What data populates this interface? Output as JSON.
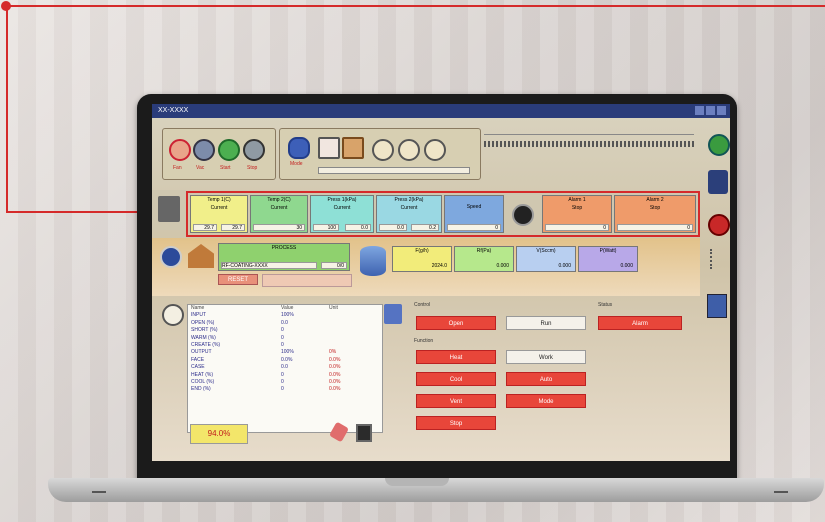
{
  "window": {
    "title": "XX-XXXX"
  },
  "toolbar": {
    "icons": [
      {
        "name": "fan-icon",
        "label": "Fan"
      },
      {
        "name": "vacuum-icon",
        "label": "Vac"
      },
      {
        "name": "runner-icon",
        "label": "Start"
      },
      {
        "name": "gauge-icon",
        "label": "Stop"
      }
    ],
    "icons2": [
      {
        "name": "user-icon",
        "label": "Mode"
      },
      {
        "name": "document-icon",
        "label": ""
      },
      {
        "name": "broom-icon",
        "label": ""
      }
    ],
    "dials_count": 3
  },
  "status_boxes": [
    {
      "title": "Temp 1(C)",
      "sub": "Current",
      "value": "29.7",
      "value2": "29.7",
      "color": "#f1ef8a"
    },
    {
      "title": "Temp 2(C)",
      "sub": "Current",
      "value": "30",
      "value2": "",
      "color": "#8fd88f"
    },
    {
      "title": "Press 1(kPa)",
      "sub": "Current",
      "value": "100",
      "value2": "0.0",
      "color": "#8ee0d6"
    },
    {
      "title": "Press 2(kPa)",
      "sub": "Current",
      "value": "0.0",
      "value2": "0.2",
      "color": "#9ad8e3"
    },
    {
      "title": "Speed",
      "sub": "",
      "value": "0",
      "value2": "",
      "color": "#7ea8de"
    },
    {
      "title": "Alarm 1",
      "sub": "Stop",
      "value": "0",
      "value2": "",
      "color": "#ef9b6a"
    },
    {
      "title": "Alarm 2",
      "sub": "Stop",
      "value": "0",
      "value2": "",
      "color": "#ef9b6a"
    }
  ],
  "process": {
    "name_label": "PROCESS",
    "name_value": "RF-COATING-XXXX",
    "count_label": "0/0",
    "reset_label": "RESET",
    "readouts": [
      {
        "label": "F(g/h)",
        "value": "2024.0",
        "color": "#f2ec7a"
      },
      {
        "label": "Rf(Pa)",
        "value": "0.000",
        "color": "#b6e88c"
      },
      {
        "label": "V(Sccm)",
        "value": "0.000",
        "color": "#b8cff0"
      },
      {
        "label": "P(Watt)",
        "value": "0.000",
        "color": "#b8a8e8"
      }
    ]
  },
  "table": {
    "headers": [
      "Name",
      "Value",
      "Unit"
    ],
    "rows": [
      [
        "INPUT",
        "100%",
        ""
      ],
      [
        "OPEN (%)",
        "0.0",
        ""
      ],
      [
        "SHORT (%)",
        "0",
        ""
      ],
      [
        "WARM (%)",
        "0",
        ""
      ],
      [
        "CREATE (%)",
        "0",
        ""
      ],
      [
        "OUTPUT",
        "100%",
        "0%"
      ],
      [
        "FACE",
        "0.0%",
        "0.0%"
      ],
      [
        "CASE",
        "0.0",
        "0.0%"
      ],
      [
        "HEAT (%)",
        "0",
        "0.0%"
      ],
      [
        "COOL (%)",
        "0",
        "0.0%"
      ],
      [
        "END (%)",
        "0",
        "0.0%"
      ]
    ],
    "total_value": "94.0%"
  },
  "controls": {
    "section1_label": "Control",
    "section2_label": "Function",
    "section3_label": "Status",
    "buttons_red": [
      "Open",
      "Heat",
      "Cool",
      "Vent",
      "Stop"
    ],
    "buttons_white": [
      "Run",
      "Work",
      "Auto",
      "Mode"
    ],
    "status_button": "Alarm"
  },
  "colors": {
    "accent": "#d52a2a",
    "titlebar": "#2a3c7a"
  }
}
